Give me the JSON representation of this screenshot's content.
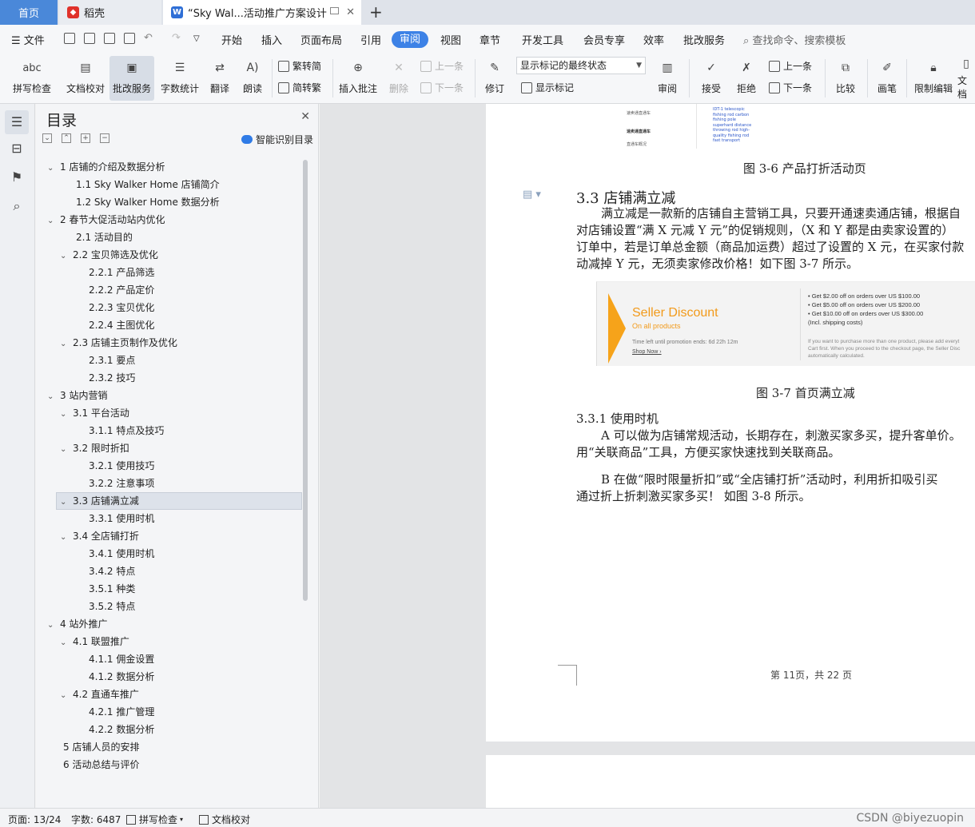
{
  "tabs": {
    "home": "首页",
    "docer": "稻壳",
    "document": "“Sky Wal...活动推广方案设计",
    "add": "+"
  },
  "menu": {
    "file": "文件",
    "items": [
      "开始",
      "插入",
      "页面布局",
      "引用",
      "审阅",
      "视图",
      "章节",
      "开发工具",
      "会员专享",
      "效率",
      "批改服务"
    ],
    "active": "审阅",
    "search_placeholder": "查找命令、搜索模板"
  },
  "ribbon": {
    "spellcheck": "拼写检查",
    "doccheck": "文档校对",
    "correction": "批改服务",
    "wordcount": "字数统计",
    "translate": "翻译",
    "read": "朗读",
    "trad_to_simp": "繁转简",
    "simp_to_trad": "简转繁",
    "insert_comment": "插入批注",
    "delete": "删除",
    "prev_comment": "上一条",
    "next_comment": "下一条",
    "track": "修订",
    "markup_select": "显示标记的最终状态",
    "show_markup": "显示标记",
    "review": "审阅",
    "accept": "接受",
    "reject": "拒绝",
    "prev_change": "上一条",
    "next_change": "下一条",
    "compare": "比较",
    "pen": "画笔",
    "restrict": "限制编辑",
    "doc_more": "文档",
    "abc": "abc"
  },
  "toc": {
    "title": "目录",
    "smart": "智能识别目录",
    "items": [
      {
        "text": "1 店铺的介绍及数据分析",
        "level": 0,
        "caret": true
      },
      {
        "text": "1.1 Sky Walker Home 店铺简介",
        "level": 1,
        "caret": false
      },
      {
        "text": "1.2 Sky Walker Home 数据分析",
        "level": 1,
        "caret": false
      },
      {
        "text": "2 春节大促活动站内优化",
        "level": 0,
        "caret": true
      },
      {
        "text": "2.1 活动目的",
        "level": 1,
        "caret": false
      },
      {
        "text": "2.2 宝贝筛选及优化",
        "level": 1,
        "caret": true
      },
      {
        "text": "2.2.1 产品筛选",
        "level": 2,
        "caret": false
      },
      {
        "text": "2.2.2 产品定价",
        "level": 2,
        "caret": false
      },
      {
        "text": "2.2.3 宝贝优化",
        "level": 2,
        "caret": false
      },
      {
        "text": "2.2.4  主图优化",
        "level": 2,
        "caret": false
      },
      {
        "text": "2.3 店铺主页制作及优化",
        "level": 1,
        "caret": true
      },
      {
        "text": "2.3.1 要点",
        "level": 2,
        "caret": false
      },
      {
        "text": "2.3.2 技巧",
        "level": 2,
        "caret": false
      },
      {
        "text": "3 站内营销",
        "level": 0,
        "caret": true
      },
      {
        "text": "3.1 平台活动",
        "level": 1,
        "caret": true
      },
      {
        "text": "3.1.1 特点及技巧",
        "level": 2,
        "caret": false
      },
      {
        "text": "3.2 限时折扣",
        "level": 1,
        "caret": true
      },
      {
        "text": "3.2.1 使用技巧",
        "level": 2,
        "caret": false
      },
      {
        "text": "3.2.2 注意事项",
        "level": 2,
        "caret": false
      },
      {
        "text": "3.3 店铺满立减",
        "level": 1,
        "caret": true
      },
      {
        "text": "3.3.1 使用时机",
        "level": 2,
        "caret": false
      },
      {
        "text": "3.4 全店铺打折",
        "level": 1,
        "caret": true
      },
      {
        "text": "3.4.1 使用时机",
        "level": 2,
        "caret": false
      },
      {
        "text": "3.4.2 特点",
        "level": 2,
        "caret": false
      },
      {
        "text": "3.5.1 种类",
        "level": 2,
        "caret": false
      },
      {
        "text": "3.5.2 特点",
        "level": 2,
        "caret": false
      },
      {
        "text": "4 站外推广",
        "level": 0,
        "caret": true
      },
      {
        "text": "4.1 联盟推广",
        "level": 1,
        "caret": true
      },
      {
        "text": "4.1.1  佣金设置",
        "level": 2,
        "caret": false
      },
      {
        "text": "4.1.2  数据分析",
        "level": 2,
        "caret": false
      },
      {
        "text": "4.2 直通车推广",
        "level": 1,
        "caret": true
      },
      {
        "text": "4.2.1 推广管理",
        "level": 2,
        "caret": false
      },
      {
        "text": "4.2.2 数据分析",
        "level": 2,
        "caret": false
      },
      {
        "text": "5 店铺人员的安排",
        "level": 0,
        "caret": false
      },
      {
        "text": "6 活动总结与评价",
        "level": 0,
        "caret": false
      }
    ],
    "selected": "3.3 店铺满立减"
  },
  "doc": {
    "img_side1": "速卖通直通车",
    "img_side2": "速卖通直通车",
    "img_side3": "直通车概况",
    "img_blue": "IDT-1 telescopic\nfishing rod carbon\nfishing pole\nsuperhard distance\nthrowing rod high-\nquality fishing rod\nfast transport",
    "caption_36": "图 3-6 产品打折活动页",
    "section_heading": "3.3 店铺满立减",
    "para1": [
      "满立减是一款新的店铺自主营销工具，只要开通速卖通店铺，根据自",
      "对店铺设置“满 X 元减 Y 元”的促销规则，（X 和 Y 都是由卖家设置的）",
      "订单中，若是订单总金额（商品加运费）超过了设置的 X 元，在买家付款",
      "动减掉 Y 元，无须卖家修改价格！如下图 3-7 所示。"
    ],
    "banner": {
      "title": "Seller Discount",
      "sub": "On all products",
      "time": "Time left until promotion ends: 6d 22h 12m",
      "shop": "Shop Now ›",
      "rules": [
        "• Get $2.00 off on orders over US $100.00",
        "• Get $5.00 off on orders over US $200.00",
        "• Get $10.00 off on orders over US $300.00",
        "(Incl. shipping costs)"
      ],
      "note": [
        "If you want to purchase more than one product, please add everyt",
        "Cart first. When you proceed to the checkout page, the Seller Disc",
        "automatically calculated."
      ]
    },
    "caption_37": "图 3-7 首页满立减",
    "sub_heading": "3.3.1 使用时机",
    "para2": [
      "A 可以做为店铺常规活动，长期存在，刺激买家多买，提升客单价。",
      "用“关联商品”工具，方便买家快速找到关联商品。"
    ],
    "para3": [
      "B 在做“限时限量折扣”或“全店铺打折”活动时，利用折扣吸引买",
      "通过折上折刺激买家多买！  如图 3-8 所示。"
    ],
    "footer": "第 11页，共  22 页"
  },
  "status": {
    "page": "页面: 13/24",
    "words": "字数: 6487",
    "spell": "拼写检查",
    "doccheck": "文档校对",
    "watermark": "CSDN @biyezuopin"
  }
}
